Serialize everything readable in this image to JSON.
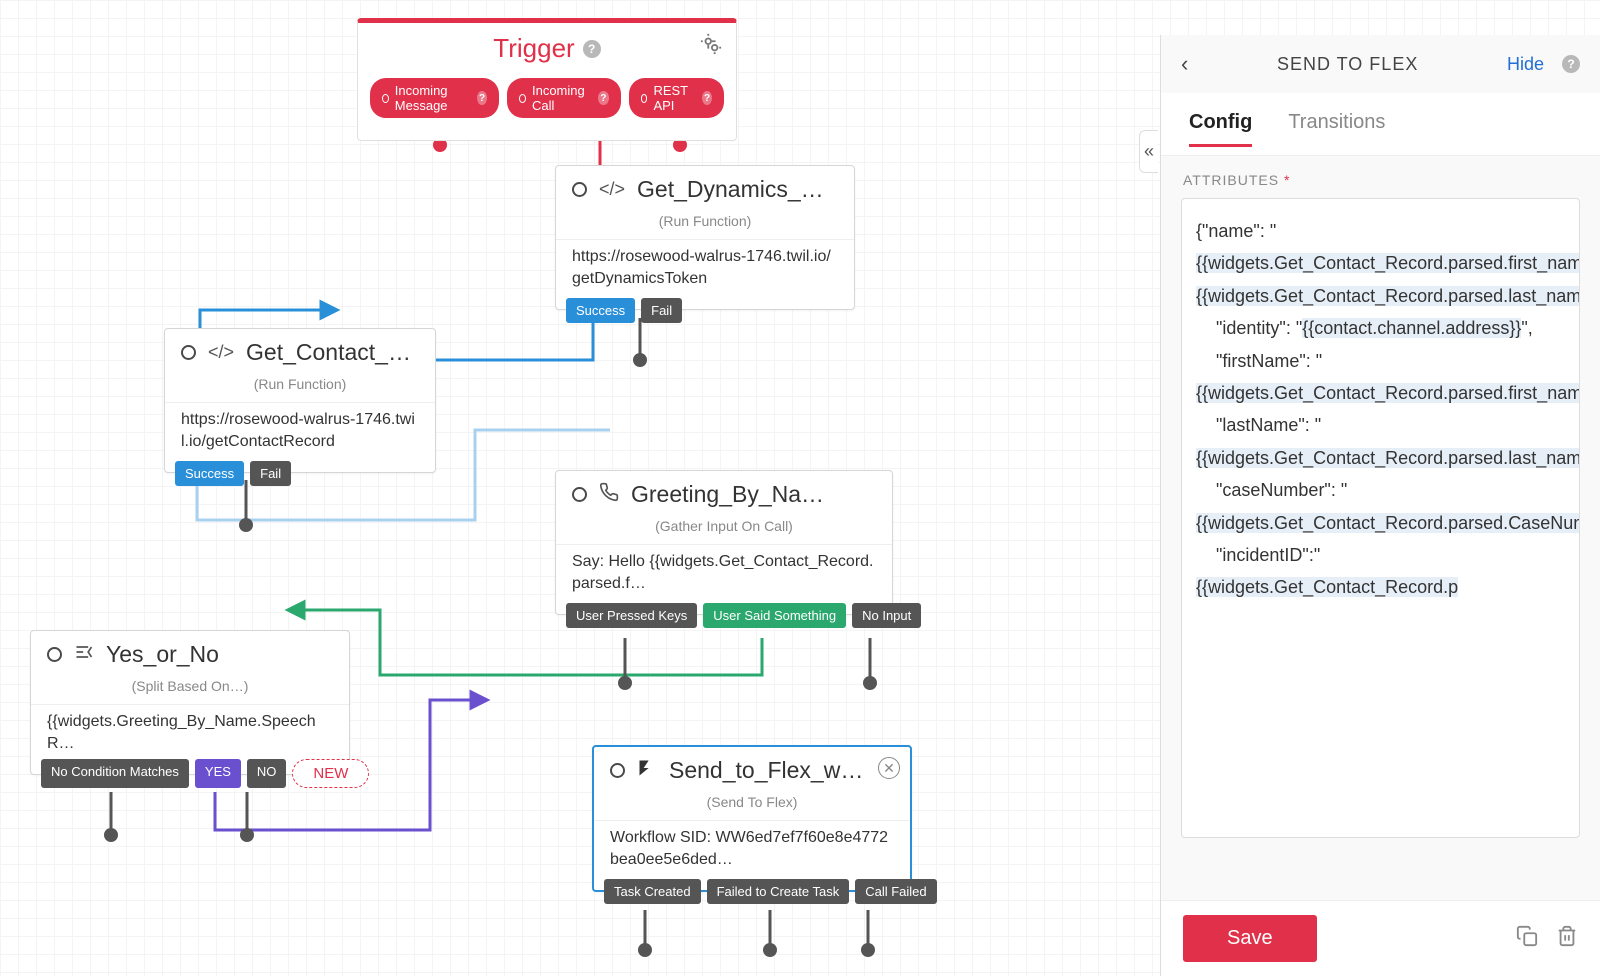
{
  "trigger": {
    "title": "Trigger",
    "pills": [
      "Incoming Message",
      "Incoming Call",
      "REST API"
    ]
  },
  "widgets": {
    "getDynamics": {
      "title": "Get_Dynamics_…",
      "subtitle": "(Run Function)",
      "body": "https://rosewood-walrus-1746.twil.io/getDynamicsToken",
      "outputs": [
        "Success",
        "Fail"
      ]
    },
    "getContact": {
      "title": "Get_Contact_Re…",
      "subtitle": "(Run Function)",
      "body": "https://rosewood-walrus-1746.twil.io/getContactRecord",
      "outputs": [
        "Success",
        "Fail"
      ]
    },
    "greeting": {
      "title": "Greeting_By_Na…",
      "subtitle": "(Gather Input On Call)",
      "body": "Say: Hello {{widgets.Get_Contact_Record.parsed.f…",
      "outputs": [
        "User Pressed Keys",
        "User Said Something",
        "No Input"
      ]
    },
    "yesno": {
      "title": "Yes_or_No",
      "subtitle": "(Split Based On…)",
      "body": "{{widgets.Greeting_By_Name.SpeechR…",
      "outputs": [
        "No Condition Matches",
        "YES",
        "NO"
      ],
      "new": "NEW"
    },
    "sendFlex": {
      "title": "Send_to_Flex_w…",
      "subtitle": "(Send To Flex)",
      "body": "Workflow SID: WW6ed7ef7f60e8e4772bea0ee5e6ded…",
      "outputs": [
        "Task Created",
        "Failed to Create Task",
        "Call Failed"
      ]
    }
  },
  "panel": {
    "title": "SEND TO FLEX",
    "hide": "Hide",
    "tabs": {
      "config": "Config",
      "transitions": "Transitions"
    },
    "sectionLabel": "ATTRIBUTES",
    "attributes": "{\"name\": \"|HL1| |HL2|\",\n    \"identity\": \"|HL3|\",\n    \"firstName\": \"|HL4|\",\n    \"lastName\": \"|HL5|\",\n    \"caseNumber\": \"|HL6|\",\n    \"incidentID\":\"|HL7|",
    "hl": {
      "1": "{{widgets.Get_Contact_Record.parsed.first_name}}",
      "2": "{{widgets.Get_Contact_Record.parsed.last_name}}",
      "3": "{{contact.channel.address}}",
      "4": "{{widgets.Get_Contact_Record.parsed.first_name}}",
      "5": "{{widgets.Get_Contact_Record.parsed.last_name}}",
      "6": "{{widgets.Get_Contact_Record.parsed.CaseNumber}}",
      "7": "{{widgets.Get_Contact_Record.p"
    },
    "save": "Save"
  }
}
